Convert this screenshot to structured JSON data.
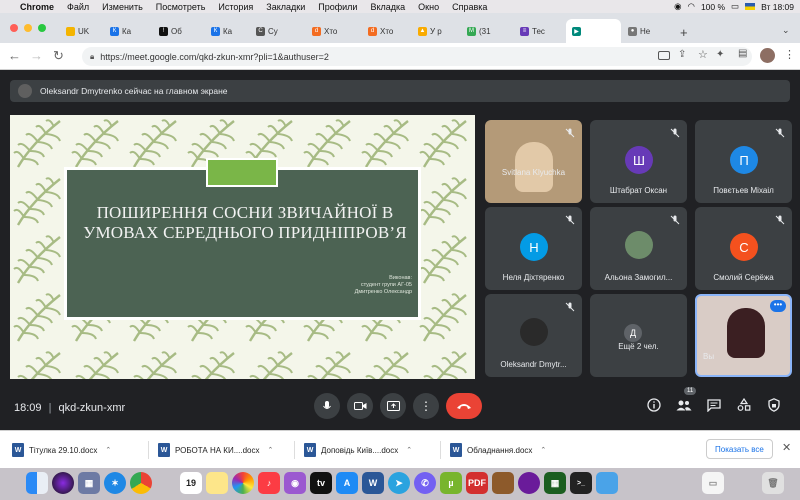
{
  "menubar": {
    "app": "Chrome",
    "items": [
      "Файл",
      "Изменить",
      "Посмотреть",
      "История",
      "Закладки",
      "Профили",
      "Вкладка",
      "Окно",
      "Справка"
    ],
    "battery": "100 %",
    "clock": "Вт 18:09"
  },
  "tabs": [
    {
      "label": "UK",
      "color": "#f4b400",
      "glyph": ""
    },
    {
      "label": "Ка",
      "color": "#1a73e8",
      "glyph": "К"
    },
    {
      "label": "Об",
      "color": "#111111",
      "glyph": "!"
    },
    {
      "label": "Ка",
      "color": "#1a73e8",
      "glyph": "К"
    },
    {
      "label": "Су",
      "color": "#555555",
      "glyph": "C"
    },
    {
      "label": "Хто",
      "color": "#f36c21",
      "glyph": "d"
    },
    {
      "label": "Хто",
      "color": "#f36c21",
      "glyph": "d"
    },
    {
      "label": "У р",
      "color": "#f9ab00",
      "glyph": "▲"
    },
    {
      "label": "(31",
      "color": "#34a853",
      "glyph": "M"
    },
    {
      "label": "Тес",
      "color": "#673ab7",
      "glyph": "≡"
    },
    {
      "label": "",
      "color": "#00897b",
      "glyph": "▶",
      "active": true
    },
    {
      "label": "Не",
      "color": "#777777",
      "glyph": "●"
    }
  ],
  "address": {
    "url": "https://meet.google.com/qkd-zkun-xmr?pli=1&authuser=2"
  },
  "meet": {
    "presenting_banner": "Oleksandr Dmytrenko сейчас на главном экране",
    "slide": {
      "title": "ПОШИРЕННЯ СОСНИ ЗВИЧАЙНОЇ В УМОВАХ СЕРЕДНЬОГО ПРИДНІПРОВ’Я",
      "author_lines": [
        "Виконав:",
        "студент групи АГ-05",
        "Дмитренко Олександр"
      ],
      "accent": "#7ab648",
      "box_color": "#4c6353"
    },
    "participants": [
      {
        "name": "Svitlana Klyuchka",
        "type": "video",
        "color": "#caa27a"
      },
      {
        "name": "Штабрат Оксан",
        "type": "avatar",
        "initial": "Ш",
        "color": "#673ab7"
      },
      {
        "name": "Повєтьев Міхаіл",
        "type": "avatar",
        "initial": "П",
        "color": "#1e88e5"
      },
      {
        "name": "Неля Діхтяренко",
        "type": "avatar",
        "initial": "Н",
        "color": "#039be5"
      },
      {
        "name": "Альона Замогил...",
        "type": "photo",
        "color": "#6d8c6a"
      },
      {
        "name": "Смолий Серёжа",
        "type": "avatar",
        "initial": "С",
        "color": "#f4511e"
      },
      {
        "name": "Oleksandr Dmytr...",
        "type": "photo",
        "color": "#2a2a2a"
      },
      {
        "name": "Ещё 2 чел.",
        "type": "more",
        "initial": "Д",
        "color": "#5f6368"
      },
      {
        "name": "Вы",
        "type": "self",
        "color": "#c9b6ad"
      }
    ],
    "time": "18:09",
    "meeting_code": "qkd-zkun-xmr",
    "participants_count": "11"
  },
  "downloads": {
    "items": [
      "Тітулка 29.10.docx",
      "РОБОТА НА КИ....docx",
      "Доповідь Київ....docx",
      "Обладнання.docx"
    ],
    "show_all": "Показать все"
  },
  "dock": {
    "calendar_day": "19"
  }
}
